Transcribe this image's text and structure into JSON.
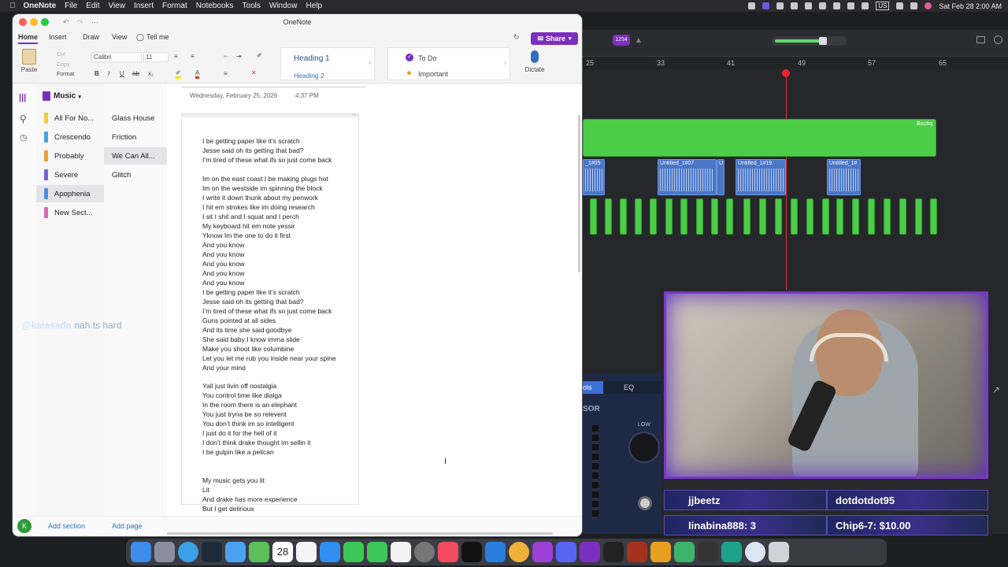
{
  "menubar": {
    "app": "OneNote",
    "items": [
      "File",
      "Edit",
      "View",
      "Insert",
      "Format",
      "Notebooks",
      "Tools",
      "Window",
      "Help"
    ],
    "datetime": "Sat Feb 28  2:00 AM",
    "input_source": "US"
  },
  "window": {
    "title": "OneNote"
  },
  "ribbon": {
    "tabs": [
      "Home",
      "Insert",
      "Draw",
      "View"
    ],
    "tell_me": "Tell me",
    "share": "Share",
    "clipboard": {
      "paste": "Paste",
      "cut": "Cut",
      "copy": "Copy",
      "format": "Format"
    },
    "font": {
      "family": "Calibri",
      "size": "11"
    },
    "styles": {
      "heading1": "Heading 1",
      "heading2": "Heading 2"
    },
    "tags": {
      "todo": "To Do",
      "important": "Important"
    },
    "dictate": "Dictate"
  },
  "notebook": {
    "name": "Music",
    "sections": [
      {
        "label": "All For No...",
        "color": "#f2c744"
      },
      {
        "label": "Crescendo",
        "color": "#4aa3df"
      },
      {
        "label": "Probably",
        "color": "#e8a13a"
      },
      {
        "label": "Severe",
        "color": "#7b5fd0"
      },
      {
        "label": "Apophenia",
        "color": "#4f8fe0"
      },
      {
        "label": "New Sect...",
        "color": "#d86ab0"
      }
    ],
    "pages": [
      "Glass House",
      "Friction",
      "We Can All...",
      "Glitch"
    ],
    "add_section": "Add section",
    "add_page": "Add page",
    "avatar": "K"
  },
  "note": {
    "date": "Wednesday, February 25, 2026",
    "time": "4:37 PM",
    "lines": [
      "I be getting paper like it’s scratch",
      "Jesse said oh its getting that bad?",
      "I’m tired of these what ifs so just come back",
      "",
      "Im on the east coast I be making plugs hot",
      "Im on the westside im spinning the block",
      "I write it down thunk about my penwork",
      "I hit em strokes like im doing research",
      "I sit I shit and I squat and I perch",
      "My keyboard hit em note yessir",
      "Yknow Im the one to do it first",
      "And you know",
      "And you know",
      "And you know",
      "And you know",
      "And you know",
      "I be getting paper like it’s scratch",
      "Jesse said oh its getting that bad?",
      "I’m tired of these what ifs so just come back",
      "Guns pointed at all sides",
      "And its time she said goodbye",
      "She said baby I know imma slide",
      "Make you shoot like columbine",
      "Let you let me rub you inside near your spine",
      "And your mind",
      "",
      "Yall just livin off nostalgia",
      "You control time like dialga",
      "In the room there is an elephant",
      "You just tryna be so relevent",
      "You don’t think im so intelligent",
      "I just do it for the hell of it",
      "I don’t think drake thought im sellin it",
      "I be gulpin like a pelican",
      "",
      "",
      "My music gets you lit",
      "Lit",
      "And drake has more experience",
      "But I get delirious"
    ]
  },
  "daw": {
    "ruler": [
      "25",
      "33",
      "41",
      "49",
      "57",
      "65"
    ],
    "region_label": "Boutiq",
    "clips": [
      "_1#05",
      "Untitled_1#07",
      "U",
      "Untitled_1#19",
      "Untitled_1#"
    ],
    "badge": "1234",
    "tab_left": "ols",
    "tab_eq": "EQ",
    "label_sor": "SOR",
    "knob_low": "LOW"
  },
  "overlay": {
    "user": "@kaiasada",
    "message": "nah ts hard"
  },
  "stream_alerts": [
    {
      "text": "jjbeetz"
    },
    {
      "text": "dotdotdot95"
    },
    {
      "text": "linabina888: 3"
    },
    {
      "text": "Chip6-7: $10.00"
    }
  ],
  "dock": {
    "calendar_day": "28"
  }
}
